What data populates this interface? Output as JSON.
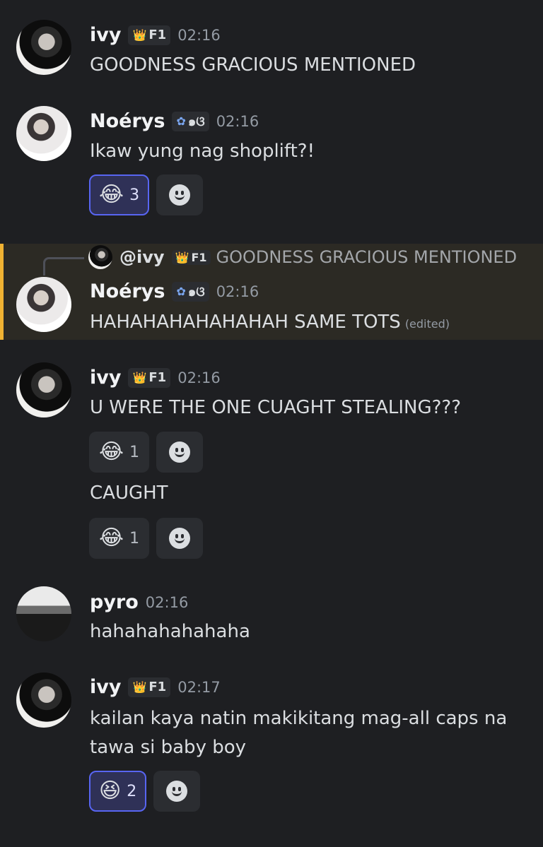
{
  "messages": {
    "m1": {
      "username": "ivy",
      "tag_icon": "👑",
      "tag": "F1",
      "time": "02:16",
      "text": "GOODNESS GRACIOUS MENTIONED"
    },
    "m2": {
      "username": "Noérys",
      "tag_icon": "✿",
      "tag": "๑ଓ",
      "time": "02:16",
      "text": "Ikaw yung nag shoplift?!",
      "reaction": {
        "emoji": "😂",
        "count": "3",
        "icon": "joy-emoji-icon"
      }
    },
    "m3": {
      "reply": {
        "username": "@ivy",
        "tag_icon": "👑",
        "tag": "F1",
        "text": "GOODNESS GRACIOUS MENTIONED"
      },
      "username": "Noérys",
      "tag_icon": "✿",
      "tag": "๑ଓ",
      "time": "02:16",
      "text": "HAHAHAHAHAHAHAH SAME TOTS",
      "edited": "(edited)"
    },
    "m4": {
      "username": "ivy",
      "tag_icon": "👑",
      "tag": "F1",
      "time": "02:16",
      "text": "U WERE THE ONE CUAGHT STEALING???",
      "reaction": {
        "emoji": "😂",
        "count": "1"
      },
      "followup_text": "CAUGHT",
      "followup_reaction": {
        "emoji": "😂",
        "count": "1"
      }
    },
    "m5": {
      "username": "pyro",
      "time": "02:16",
      "text": "hahahahahahaha"
    },
    "m6": {
      "username": "ivy",
      "tag_icon": "👑",
      "tag": "F1",
      "time": "02:17",
      "text_line1": "kailan kaya natin makikitang mag-all caps na",
      "text_line2": "tawa si baby boy",
      "reaction": {
        "emoji": "😆",
        "count": "2"
      }
    }
  },
  "colors": {
    "background": "#1e1f22",
    "accent": "#5865f2",
    "highlight_border": "#f0b232"
  }
}
